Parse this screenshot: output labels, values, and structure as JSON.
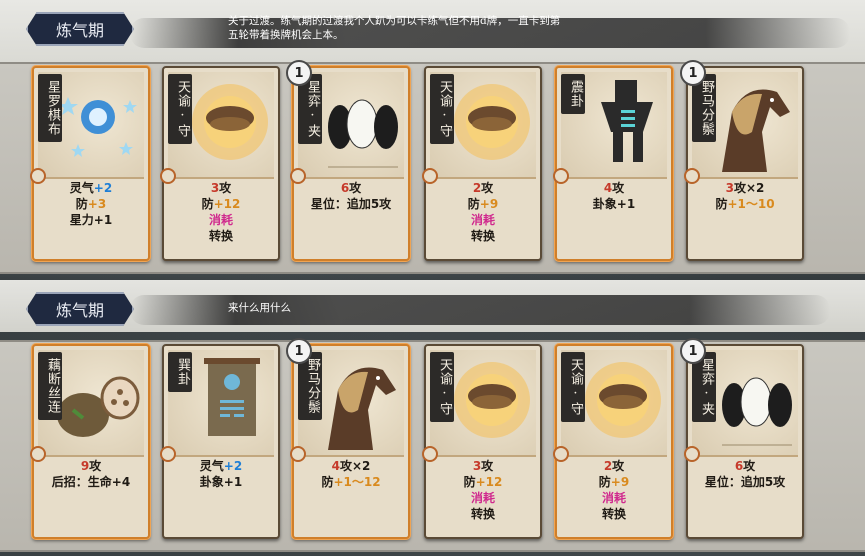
{
  "section1": {
    "stage": "炼气期",
    "note": [
      "关于过渡。练气期的过渡我个人趴为可以卡练气但不用d牌，一直卡到第",
      "五轮带着换牌机会上本。"
    ],
    "cards": [
      {
        "name": "星罗棋布",
        "level": "",
        "icon": "star-galaxy-icon",
        "lines": [
          {
            "t": "灵气",
            "v": "+2",
            "c": "blue"
          },
          {
            "t": "防",
            "v": "+3",
            "c": "orange"
          },
          {
            "t": "星力+1",
            "v": "",
            "c": ""
          }
        ]
      },
      {
        "name": "天谕·守",
        "level": "",
        "icon": "tortoise-shell-icon",
        "lines": [
          {
            "pre": "3",
            "t": "攻",
            "c": "red"
          },
          {
            "t": "防",
            "v": "+12",
            "c": "orange"
          },
          {
            "t": "消耗",
            "c": "pink",
            "full": true
          },
          {
            "t": "转换"
          }
        ]
      },
      {
        "name": "星弈·夹",
        "level": "1",
        "icon": "go-stones-icon",
        "lines": [
          {
            "pre": "6",
            "t": "攻",
            "c": "red"
          },
          {
            "t": "星位：追加5攻"
          }
        ]
      },
      {
        "name": "天谕·守",
        "level": "",
        "icon": "tortoise-shell-icon",
        "lines": [
          {
            "pre": "2",
            "t": "攻",
            "c": "red"
          },
          {
            "t": "防",
            "v": "+9",
            "c": "orange"
          },
          {
            "t": "消耗",
            "c": "pink",
            "full": true
          },
          {
            "t": "转换"
          }
        ]
      },
      {
        "name": "震卦",
        "level": "",
        "icon": "zhen-trigram-figure-icon",
        "lines": [
          {
            "pre": "4",
            "t": "攻",
            "c": "red"
          },
          {
            "t": "卦象+1"
          }
        ]
      },
      {
        "name": "野马分鬃",
        "level": "1",
        "icon": "horse-icon",
        "lines": [
          {
            "pre": "3",
            "t": "攻×2",
            "c": "red"
          },
          {
            "t": "防",
            "v": "+1～10",
            "c": "orange"
          }
        ]
      }
    ]
  },
  "section2": {
    "stage": "炼气期",
    "note": [
      "来什么用什么"
    ],
    "cards": [
      {
        "name": "藕断丝连",
        "level": "",
        "icon": "lotus-root-icon",
        "lines": [
          {
            "pre": "9",
            "t": "攻",
            "c": "red"
          },
          {
            "t": "后招：生命+4"
          }
        ]
      },
      {
        "name": "巽卦",
        "level": "",
        "icon": "xun-trigram-banner-icon",
        "lines": [
          {
            "t": "灵气",
            "v": "+2",
            "c": "blue"
          },
          {
            "t": "卦象+1"
          }
        ]
      },
      {
        "name": "野马分鬃",
        "level": "1",
        "icon": "horse-icon",
        "lines": [
          {
            "pre": "4",
            "t": "攻×2",
            "c": "red"
          },
          {
            "t": "防",
            "v": "+1～12",
            "c": "orange"
          }
        ]
      },
      {
        "name": "天谕·守",
        "level": "",
        "icon": "tortoise-shell-icon",
        "lines": [
          {
            "pre": "3",
            "t": "攻",
            "c": "red"
          },
          {
            "t": "防",
            "v": "+12",
            "c": "orange"
          },
          {
            "t": "消耗",
            "c": "pink",
            "full": true
          },
          {
            "t": "转换"
          }
        ]
      },
      {
        "name": "天谕·守",
        "level": "",
        "icon": "tortoise-shell-icon",
        "lines": [
          {
            "pre": "2",
            "t": "攻",
            "c": "red"
          },
          {
            "t": "防",
            "v": "+9",
            "c": "orange"
          },
          {
            "t": "消耗",
            "c": "pink",
            "full": true
          },
          {
            "t": "转换"
          }
        ]
      },
      {
        "name": "星弈·夹",
        "level": "1",
        "icon": "go-stones-icon",
        "lines": [
          {
            "pre": "6",
            "t": "攻",
            "c": "red"
          },
          {
            "t": "星位：追加5攻"
          }
        ]
      }
    ]
  }
}
